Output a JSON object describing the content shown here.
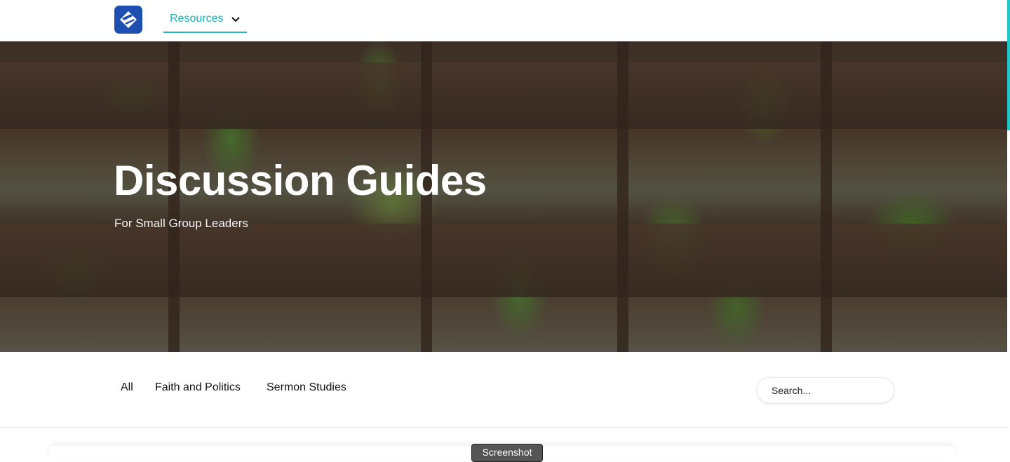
{
  "nav": {
    "logo": "brand-logo",
    "resources_label": "Resources",
    "accent_color": "#16b5bd",
    "logo_color": "#1c4fb0"
  },
  "hero": {
    "title": "Discussion Guides",
    "subtitle": "For Small Group Leaders"
  },
  "filters": {
    "items": [
      "All",
      "Faith and Politics",
      "Sermon Studies"
    ],
    "search_placeholder": "Search..."
  },
  "footer": {
    "screenshot_label": "Screenshot"
  }
}
